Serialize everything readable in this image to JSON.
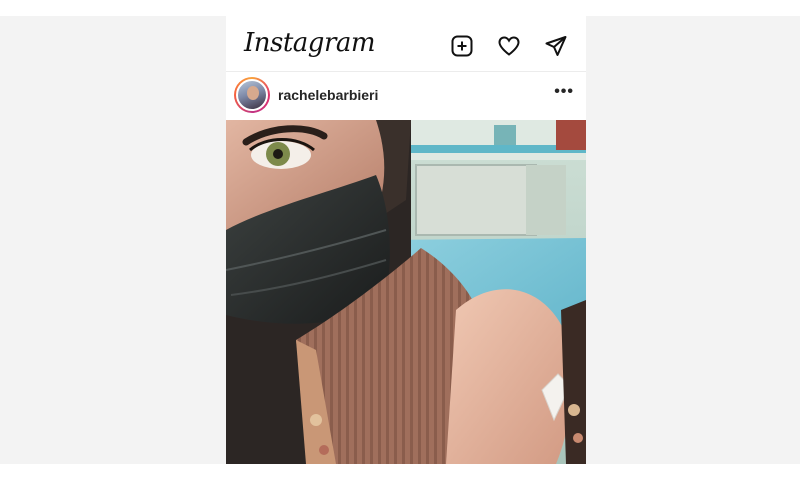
{
  "app": {
    "logo_text": "Instagram"
  },
  "header": {
    "icons": [
      "add-post-icon",
      "heart-icon",
      "direct-message-icon"
    ]
  },
  "post": {
    "username": "rachelebarbieri",
    "more_label": "•••",
    "photo_icon": "selfie-photo"
  },
  "colors": {
    "text": "#262626",
    "border": "#ececec",
    "story_ring": "#e1306c",
    "backdrop": "#f3f3f3"
  }
}
